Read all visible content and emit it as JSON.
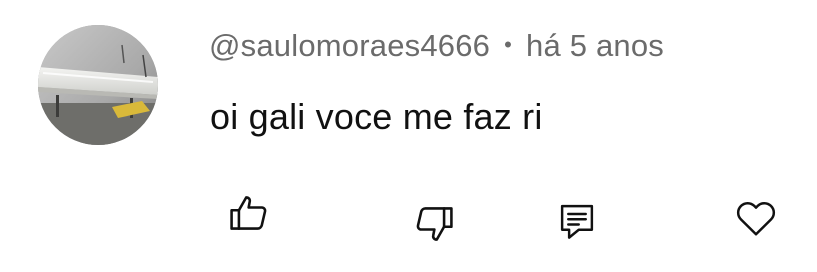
{
  "comment": {
    "username": "@saulomoraes4666",
    "separator": "•",
    "timestamp": "há 5 anos",
    "text": "oi gali voce me faz ri"
  },
  "actions": {
    "like_icon": "thumbs-up-icon",
    "dislike_icon": "thumbs-down-icon",
    "reply_icon": "comment-icon",
    "heart_icon": "heart-icon"
  },
  "colors": {
    "meta_text": "#6b6b6b",
    "body_text": "#111111",
    "icon_stroke": "#111111"
  }
}
